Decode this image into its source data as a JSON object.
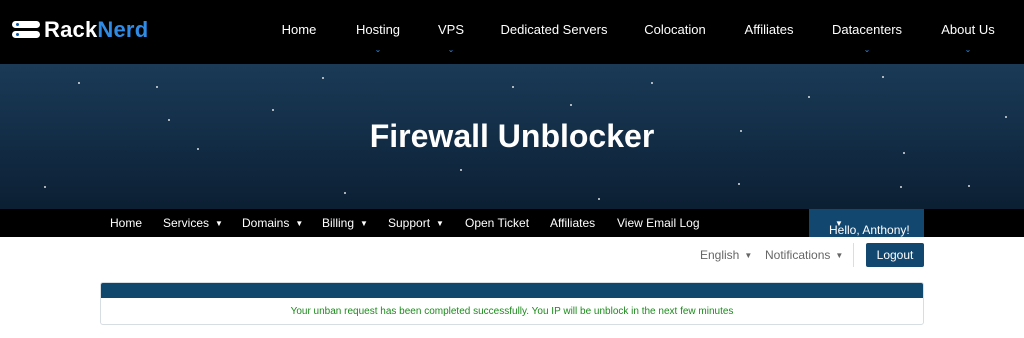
{
  "brand": {
    "part1": "Rack",
    "part2": "Nerd"
  },
  "main_nav": [
    {
      "label": "Home",
      "has_dropdown": false
    },
    {
      "label": "Hosting",
      "has_dropdown": true
    },
    {
      "label": "VPS",
      "has_dropdown": true
    },
    {
      "label": "Dedicated Servers",
      "has_dropdown": false
    },
    {
      "label": "Colocation",
      "has_dropdown": false
    },
    {
      "label": "Affiliates",
      "has_dropdown": false
    },
    {
      "label": "Datacenters",
      "has_dropdown": true
    },
    {
      "label": "About Us",
      "has_dropdown": true
    }
  ],
  "hero": {
    "title": "Firewall Unblocker"
  },
  "sub_nav": [
    {
      "label": "Home",
      "has_dropdown": false
    },
    {
      "label": "Services",
      "has_dropdown": true
    },
    {
      "label": "Domains",
      "has_dropdown": true
    },
    {
      "label": "Billing",
      "has_dropdown": true
    },
    {
      "label": "Support",
      "has_dropdown": true
    },
    {
      "label": "Open Ticket",
      "has_dropdown": false
    },
    {
      "label": "Affiliates",
      "has_dropdown": false
    },
    {
      "label": "View Email Log",
      "has_dropdown": false
    }
  ],
  "user_menu": {
    "label": "Hello, Anthony!"
  },
  "utility": {
    "language": "English",
    "notifications": "Notifications",
    "logout": "Logout"
  },
  "alert": {
    "message": "Your unban request has been completed successfully. You IP will be unblock in the next few minutes"
  },
  "colors": {
    "nav_bg": "#000000",
    "accent": "#12476f",
    "brand_blue": "#2f8be6",
    "success_text": "#1c8a1c"
  }
}
